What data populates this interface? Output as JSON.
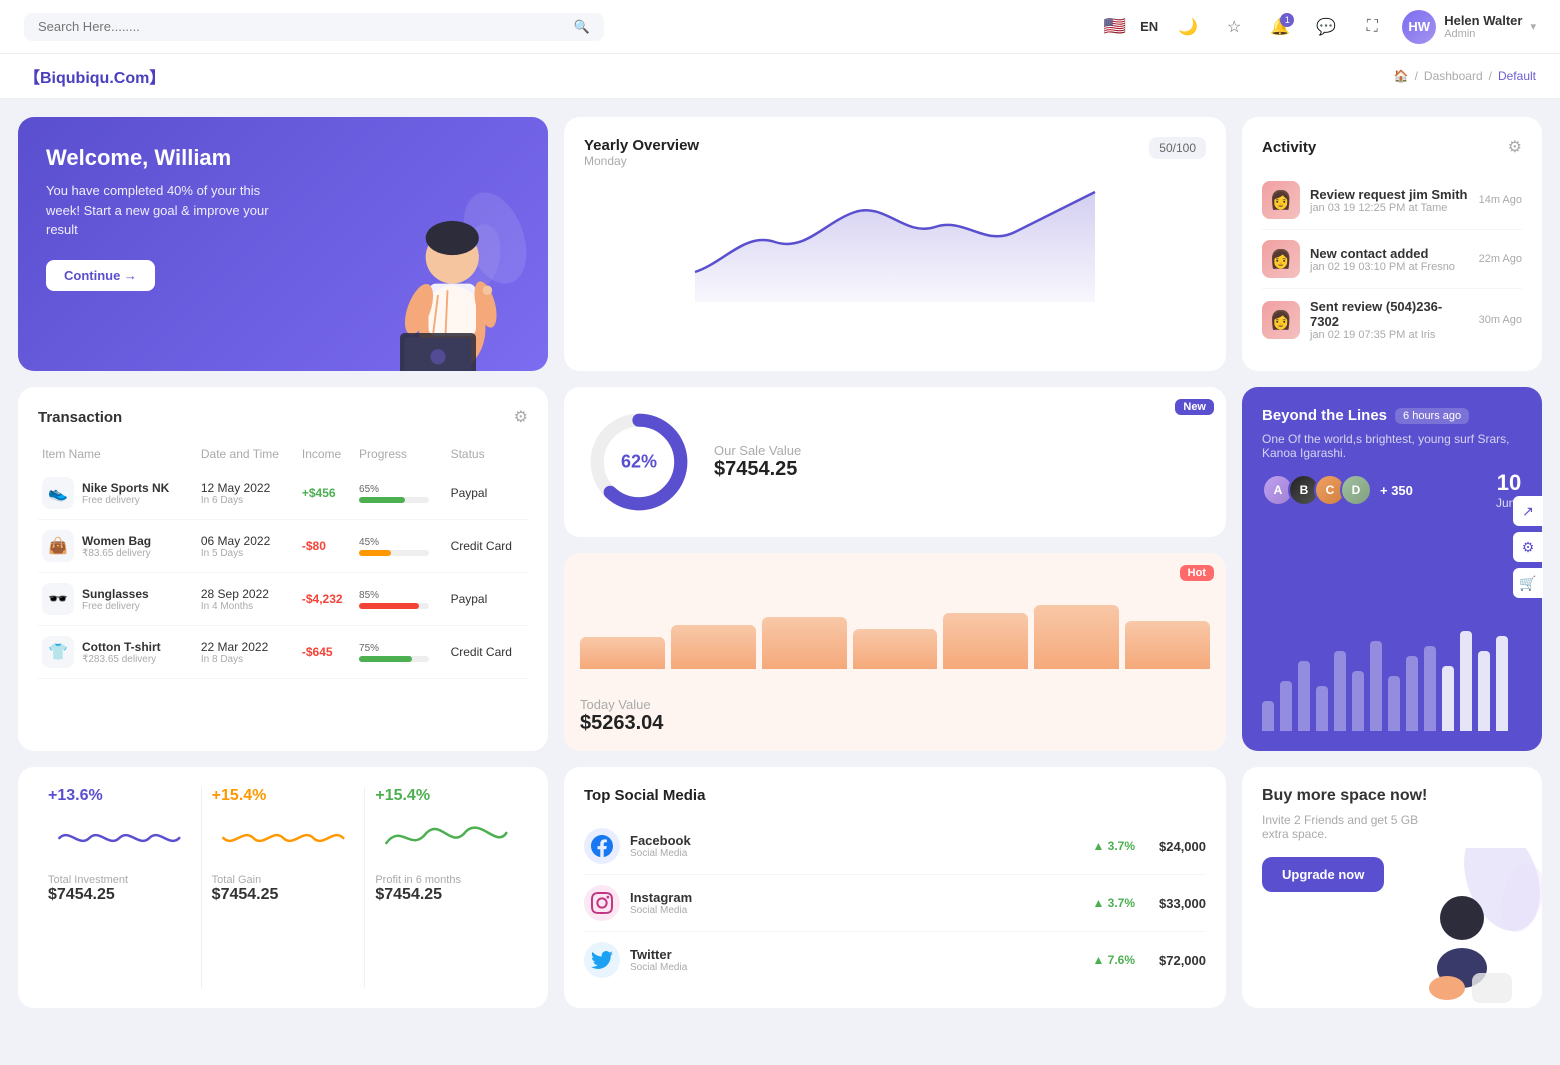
{
  "topnav": {
    "search_placeholder": "Search Here........",
    "lang": "EN",
    "user": {
      "name": "Helen Walter",
      "role": "Admin",
      "initials": "HW"
    },
    "notification_count": "1"
  },
  "breadcrumb": {
    "logo": "【Biqubiqu.Com】",
    "home": "🏠",
    "path": [
      "Dashboard",
      "Default"
    ]
  },
  "welcome": {
    "title": "Welcome, William",
    "description": "You have completed 40% of your this week! Start a new goal & improve your result",
    "button": "Continue →"
  },
  "yearly_overview": {
    "title": "Yearly Overview",
    "subtitle": "Monday",
    "badge": "50/100"
  },
  "activity": {
    "title": "Activity",
    "items": [
      {
        "title": "Review request jim Smith",
        "subtitle": "jan 03 19 12:25 PM at Tame",
        "time": "14m Ago",
        "emoji": "👩"
      },
      {
        "title": "New contact added",
        "subtitle": "jan 02 19 03:10 PM at Fresno",
        "time": "22m Ago",
        "emoji": "👩"
      },
      {
        "title": "Sent review (504)236-7302",
        "subtitle": "jan 02 19 07:35 PM at Iris",
        "time": "30m Ago",
        "emoji": "👩"
      }
    ]
  },
  "transaction": {
    "title": "Transaction",
    "columns": [
      "Item Name",
      "Date and Time",
      "Income",
      "Progress",
      "Status"
    ],
    "rows": [
      {
        "name": "Nike Sports NK",
        "sub": "Free delivery",
        "date": "12 May 2022",
        "dateInfo": "In 6 Days",
        "income": "+$456",
        "positive": true,
        "progress": 65,
        "progressColor": "#4caf50",
        "status": "Paypal",
        "emoji": "👟"
      },
      {
        "name": "Women Bag",
        "sub": "₹83.65 delivery",
        "date": "06 May 2022",
        "dateInfo": "In 5 Days",
        "income": "-$80",
        "positive": false,
        "progress": 45,
        "progressColor": "#ff9800",
        "status": "Credit Card",
        "emoji": "👜"
      },
      {
        "name": "Sunglasses",
        "sub": "Free delivery",
        "date": "28 Sep 2022",
        "dateInfo": "In 4 Months",
        "income": "-$4,232",
        "positive": false,
        "progress": 85,
        "progressColor": "#f44336",
        "status": "Paypal",
        "emoji": "🕶️"
      },
      {
        "name": "Cotton T-shirt",
        "sub": "₹283.65 delivery",
        "date": "22 Mar 2022",
        "dateInfo": "In 8 Days",
        "income": "-$645",
        "positive": false,
        "progress": 75,
        "progressColor": "#4caf50",
        "status": "Credit Card",
        "emoji": "👕"
      }
    ]
  },
  "sale1": {
    "badge": "New",
    "donut_pct": "62%",
    "donut_value": 62,
    "label": "Our Sale Value",
    "value": "$7454.25"
  },
  "sale2": {
    "badge": "Hot",
    "label": "Today Value",
    "value": "$5263.04",
    "bars": [
      40,
      55,
      65,
      50,
      70,
      80,
      60
    ]
  },
  "barchart": {
    "title": "Beyond the Lines",
    "time_ago": "6 hours ago",
    "description": "One Of the world,s brightest, young surf Srars, Kanoa Igarashi.",
    "avatar_plus": "+ 350",
    "date_day": "10",
    "date_month": "June",
    "bars": [
      30,
      50,
      70,
      45,
      80,
      60,
      90,
      55,
      75,
      85,
      65,
      100,
      80,
      95
    ]
  },
  "ministats": {
    "items": [
      {
        "pct": "+13.6%",
        "label": "Total Investment",
        "value": "$7454.25",
        "color": "#5a4fce"
      },
      {
        "pct": "+15.4%",
        "label": "Total Gain",
        "value": "$7454.25",
        "color": "#ff9800"
      },
      {
        "pct": "+15.4%",
        "label": "Profit in 6 months",
        "value": "$7454.25",
        "color": "#4caf50"
      }
    ]
  },
  "social": {
    "title": "Top Social Media",
    "items": [
      {
        "name": "Facebook",
        "sub": "Social Media",
        "pct": "3.7%",
        "value": "$24,000",
        "icon": "fb"
      },
      {
        "name": "Instagram",
        "sub": "Social Media",
        "pct": "3.7%",
        "value": "$33,000",
        "icon": "ig"
      },
      {
        "name": "Twitter",
        "sub": "Social Media",
        "pct": "7.6%",
        "value": "$72,000",
        "icon": "tw"
      }
    ]
  },
  "buyspace": {
    "title": "Buy more space now!",
    "description": "Invite 2 Friends and get 5 GB extra space.",
    "button": "Upgrade now"
  }
}
